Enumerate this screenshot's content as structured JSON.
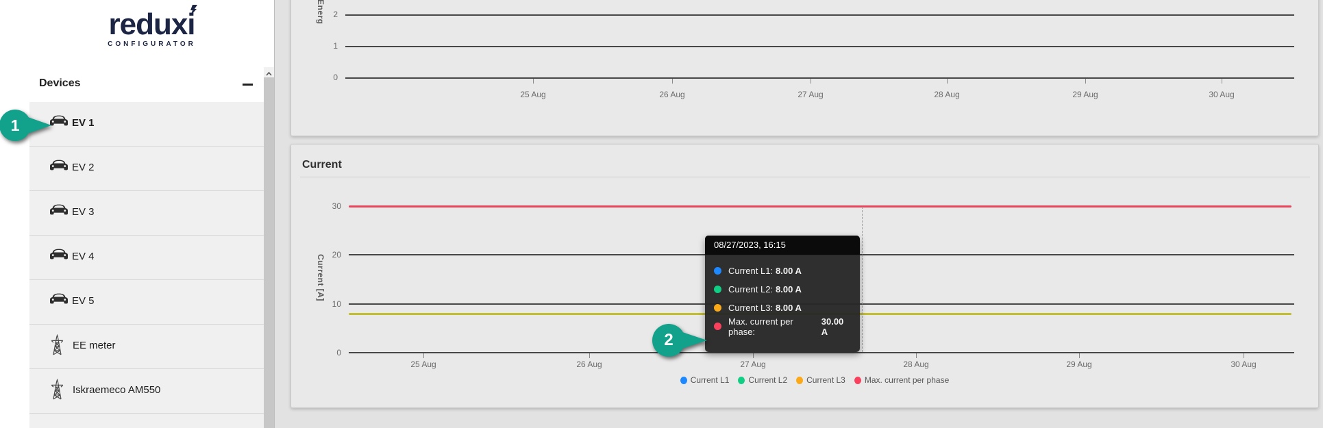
{
  "app": {
    "logo": "reduxi",
    "logo_subtitle": "CONFIGURATOR"
  },
  "colors": {
    "teal": "#12A18B",
    "logo_navy": "#1C2543",
    "line_red": "#E8455C",
    "line_yellow": "#C2BE2F",
    "dot_blue": "#1E88FF",
    "dot_green": "#10CE83",
    "dot_amber": "#FBA919",
    "dot_red": "#F9415E"
  },
  "sidebar": {
    "header": "Devices",
    "collapse_label": "minus",
    "scroll_up_icon": "chevron-up",
    "items": [
      {
        "label": "EV 1",
        "icon": "car",
        "active": true
      },
      {
        "label": "EV 2",
        "icon": "car",
        "active": false
      },
      {
        "label": "EV 3",
        "icon": "car",
        "active": false
      },
      {
        "label": "EV 4",
        "icon": "car",
        "active": false
      },
      {
        "label": "EV 5",
        "icon": "car",
        "active": false
      },
      {
        "label": "EE meter",
        "icon": "tower",
        "active": false
      },
      {
        "label": "Iskraemeco AM550",
        "icon": "tower",
        "active": false
      }
    ]
  },
  "annotations": {
    "badge1": "1",
    "badge2": "2"
  },
  "energy_chart": {
    "y_label_visible": "Energ",
    "y_ticks": [
      "2",
      "1",
      "0"
    ],
    "x_ticks": [
      "25 Aug",
      "26 Aug",
      "27 Aug",
      "28 Aug",
      "29 Aug",
      "30 Aug"
    ]
  },
  "current_chart": {
    "title": "Current",
    "y_label": "Current [A]",
    "y_ticks": [
      "30",
      "20",
      "10",
      "0"
    ],
    "x_ticks": [
      "25 Aug",
      "26 Aug",
      "27 Aug",
      "28 Aug",
      "29 Aug",
      "30 Aug"
    ],
    "legend": [
      {
        "label": "Current L1",
        "color_key": "dot_blue"
      },
      {
        "label": "Current L2",
        "color_key": "dot_green"
      },
      {
        "label": "Current L3",
        "color_key": "dot_amber"
      },
      {
        "label": "Max. current per phase",
        "color_key": "dot_red"
      }
    ]
  },
  "tooltip": {
    "title": "08/27/2023, 16:15",
    "rows": [
      {
        "label": "Current L1:",
        "value": "8.00 A",
        "color_key": "dot_blue"
      },
      {
        "label": "Current L2:",
        "value": "8.00 A",
        "color_key": "dot_green"
      },
      {
        "label": "Current L3:",
        "value": "8.00 A",
        "color_key": "dot_amber"
      },
      {
        "label": "Max. current per phase:",
        "value": "30.00 A",
        "color_key": "dot_red"
      }
    ]
  },
  "chart_data": [
    {
      "id": "energy",
      "type": "line",
      "title": "",
      "ylabel": "Energ (cut off, vertical)",
      "xlabel": "",
      "y_ticks": [
        0,
        1,
        2
      ],
      "ylim": [
        0,
        2
      ],
      "x_categories": [
        "25 Aug",
        "26 Aug",
        "27 Aug",
        "28 Aug",
        "29 Aug",
        "30 Aug"
      ],
      "series": [],
      "grid": true,
      "legend_position": "none"
    },
    {
      "id": "current",
      "type": "line",
      "title": "Current",
      "ylabel": "Current [A]",
      "xlabel": "",
      "y_ticks": [
        0,
        10,
        20,
        30
      ],
      "ylim": [
        0,
        32
      ],
      "x_categories": [
        "25 Aug",
        "26 Aug",
        "27 Aug",
        "28 Aug",
        "29 Aug",
        "30 Aug"
      ],
      "series": [
        {
          "name": "Current L1",
          "constant_value": 8.0
        },
        {
          "name": "Current L2",
          "constant_value": 8.0
        },
        {
          "name": "Current L3",
          "constant_value": 8.0
        },
        {
          "name": "Max. current per phase",
          "constant_value": 30.0
        }
      ],
      "hover_point": {
        "time": "08/27/2023, 16:15",
        "values": {
          "Current L1": 8.0,
          "Current L2": 8.0,
          "Current L3": 8.0,
          "Max. current per phase": 30.0
        }
      },
      "grid": true,
      "legend_position": "bottom-center"
    }
  ]
}
